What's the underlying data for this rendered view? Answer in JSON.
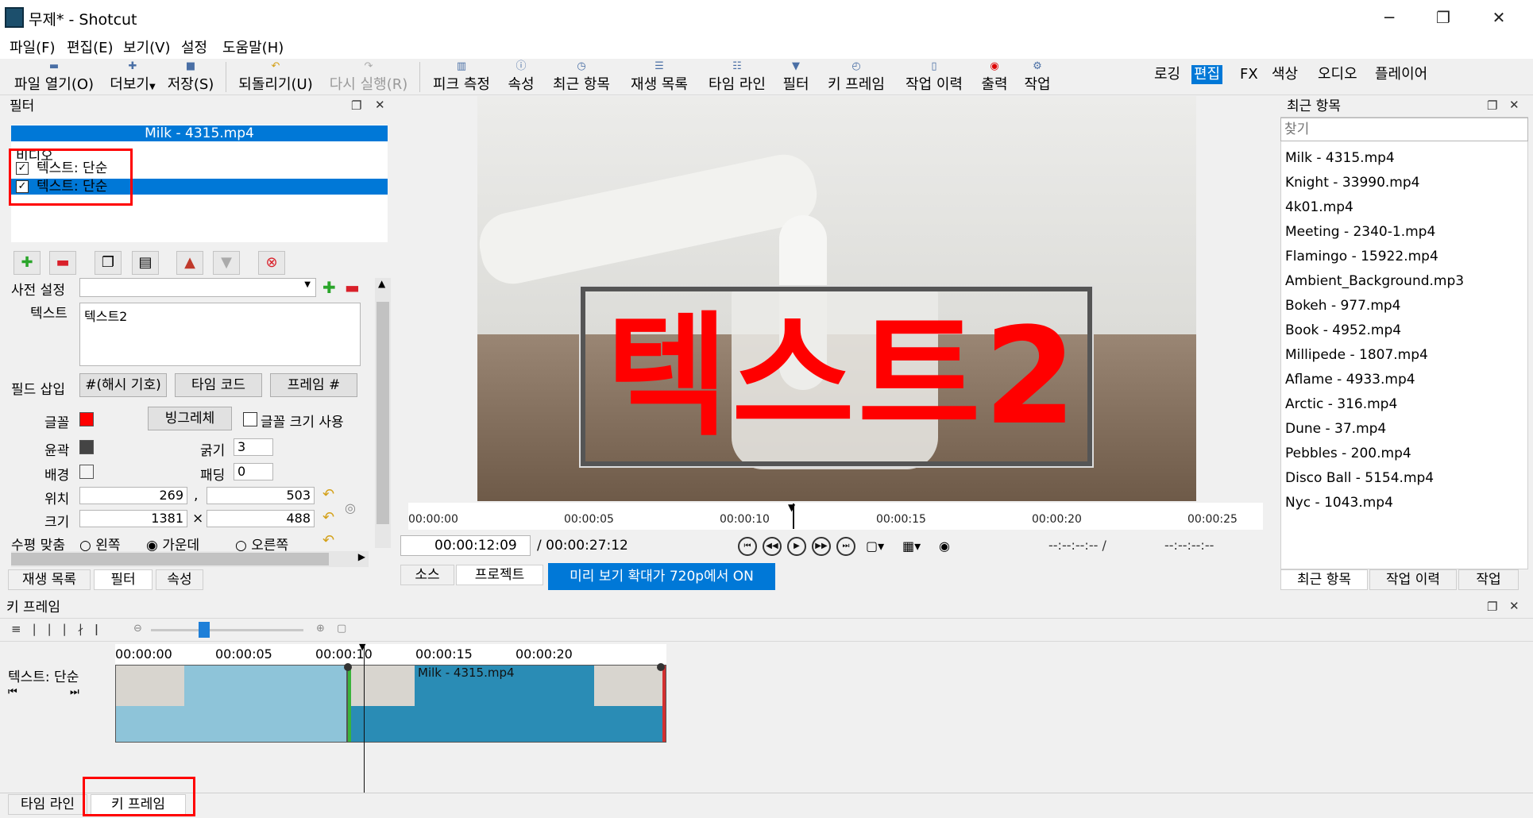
{
  "window": {
    "title": "무제* - Shotcut",
    "min": "─",
    "max": "❐",
    "close": "✕"
  },
  "menu": [
    "파일(F)",
    "편집(E)",
    "보기(V)",
    "설정",
    "도움말(H)"
  ],
  "toolbar": {
    "items": [
      "파일 열기(O)",
      "더보기",
      "저장(S)",
      "되돌리기(U)",
      "다시 실행(R)",
      "피크 측정",
      "속성",
      "최근 항목",
      "재생 목록",
      "타임 라인",
      "필터",
      "키 프레임",
      "작업 이력",
      "출력",
      "작업"
    ],
    "layouts": [
      "로깅",
      "편집",
      "FX",
      "색상",
      "오디오",
      "플레이어"
    ]
  },
  "filters": {
    "title": "필터",
    "clip": "Milk - 4315.mp4",
    "category": "비디오",
    "rows": [
      "텍스트: 단순",
      "텍스트: 단순"
    ],
    "preset_label": "사전 설정",
    "text_label": "텍스트",
    "text_value": "텍스트2",
    "insert_label": "필드 삽입",
    "insert_buttons": [
      "#(해시 기호)",
      "타임 코드",
      "프레임 #"
    ],
    "font_label": "글꼴",
    "font_button": "빙그레체",
    "font_size_label": "글꼴 크기 사용",
    "outline_label": "윤곽",
    "thickness_label": "굵기",
    "thickness_value": "3",
    "bg_label": "배경",
    "padding_label": "패딩",
    "padding_value": "0",
    "pos_label": "위치",
    "pos_x": "269",
    "pos_y": "503",
    "comma": ",",
    "size_label": "크기",
    "size_w": "1381",
    "size_h": "488",
    "times": "×",
    "halign_label": "수평 맞춤",
    "halign": [
      "왼쪽",
      "가운데",
      "오른쪽"
    ],
    "tabs": [
      "재생 목록",
      "필터",
      "속성"
    ],
    "font_color": "#ff0000"
  },
  "player": {
    "overlay_text": "텍스트2",
    "ruler": [
      "00:00:00",
      "00:00:05",
      "00:00:10",
      "00:00:15",
      "00:00:20",
      "00:00:25"
    ],
    "current": "00:00:12:09",
    "duration": "/ 00:00:27:12",
    "in_out_a": "--:--:--:-- /",
    "in_out_b": "--:--:--:--",
    "tabs": [
      "소스",
      "프로젝트"
    ],
    "zoom_notice": "미리 보기 확대가 720p에서 ON"
  },
  "recent": {
    "title": "최근 항목",
    "search_placeholder": "찾기",
    "items": [
      "Milk - 4315.mp4",
      "Knight - 33990.mp4",
      "4k01.mp4",
      "Meeting - 2340-1.mp4",
      "Flamingo - 15922.mp4",
      "Ambient_Background.mp3",
      "Bokeh - 977.mp4",
      "Book - 4952.mp4",
      "Millipede - 1807.mp4",
      "Aflame - 4933.mp4",
      "Arctic - 316.mp4",
      "Dune - 37.mp4",
      "Pebbles - 200.mp4",
      "Disco Ball - 5154.mp4",
      "Nyc - 1043.mp4"
    ],
    "tabs": [
      "최근 항목",
      "작업 이력",
      "작업"
    ]
  },
  "keyframes": {
    "title": "키 프레임",
    "track_label": "텍스트: 단순",
    "ruler": [
      "00:00:00",
      "00:00:05",
      "00:00:10",
      "00:00:15",
      "00:00:20"
    ],
    "clip_name": "Milk - 4315.mp4",
    "bottom_tabs": [
      "타임 라인",
      "키 프레임"
    ]
  }
}
